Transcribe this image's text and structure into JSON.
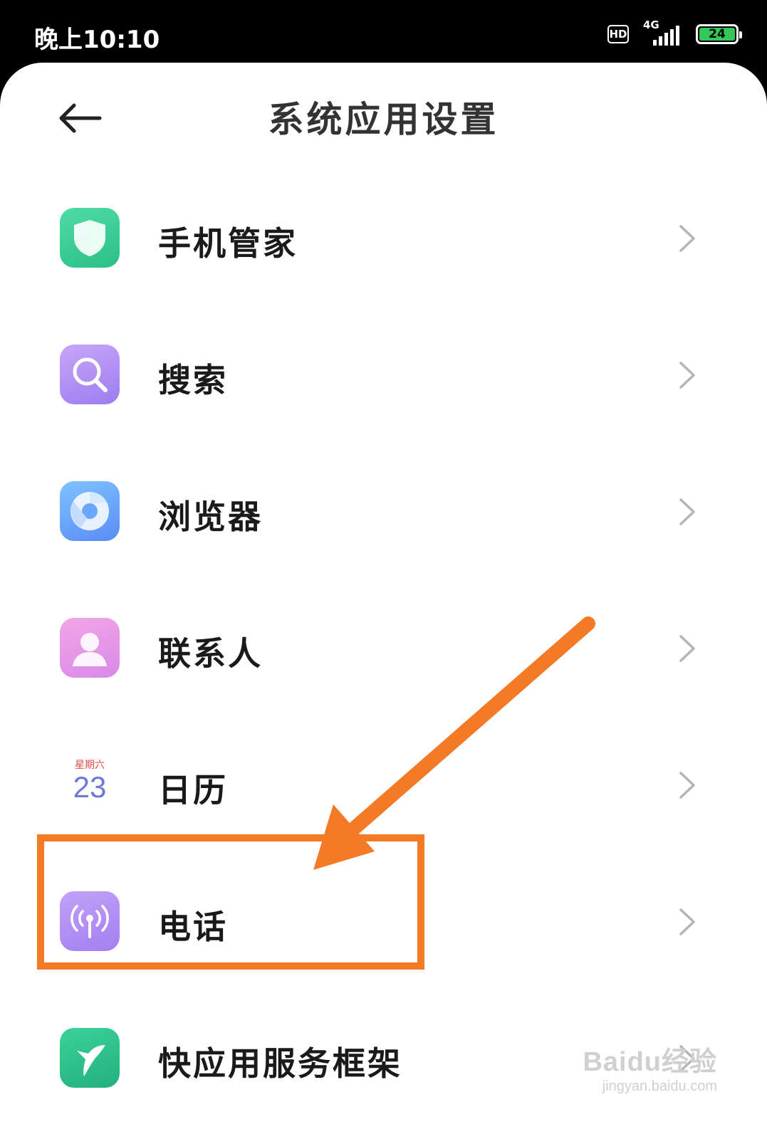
{
  "status_bar": {
    "time": "晚上10:10",
    "hd_label": "HD",
    "network": "4G",
    "battery": "24",
    "icons": [
      "hd-icon",
      "signal-icon",
      "battery-icon"
    ]
  },
  "header": {
    "title": "系统应用设置",
    "back_icon": "arrow-left-icon"
  },
  "list": {
    "items": [
      {
        "label": "手机管家",
        "icon": "shield-icon",
        "chevron": "chevron-right-icon"
      },
      {
        "label": "搜索",
        "icon": "search-icon",
        "chevron": "chevron-right-icon"
      },
      {
        "label": "浏览器",
        "icon": "browser-icon",
        "chevron": "chevron-right-icon"
      },
      {
        "label": "联系人",
        "icon": "contacts-icon",
        "chevron": "chevron-right-icon"
      },
      {
        "label": "日历",
        "icon": "calendar-icon",
        "calendar_weekday": "星期六",
        "calendar_day": "23",
        "chevron": "chevron-right-icon"
      },
      {
        "label": "电话",
        "icon": "phone-signal-icon",
        "chevron": "chevron-right-icon"
      },
      {
        "label": "快应用服务框架",
        "icon": "hummingbird-icon",
        "chevron": "chevron-right-icon"
      }
    ]
  },
  "annotation": {
    "highlighted_item": "电话",
    "color": "#f47a26"
  },
  "watermark": {
    "logo": "Baidu经验",
    "url": "jingyan.baidu.com"
  }
}
